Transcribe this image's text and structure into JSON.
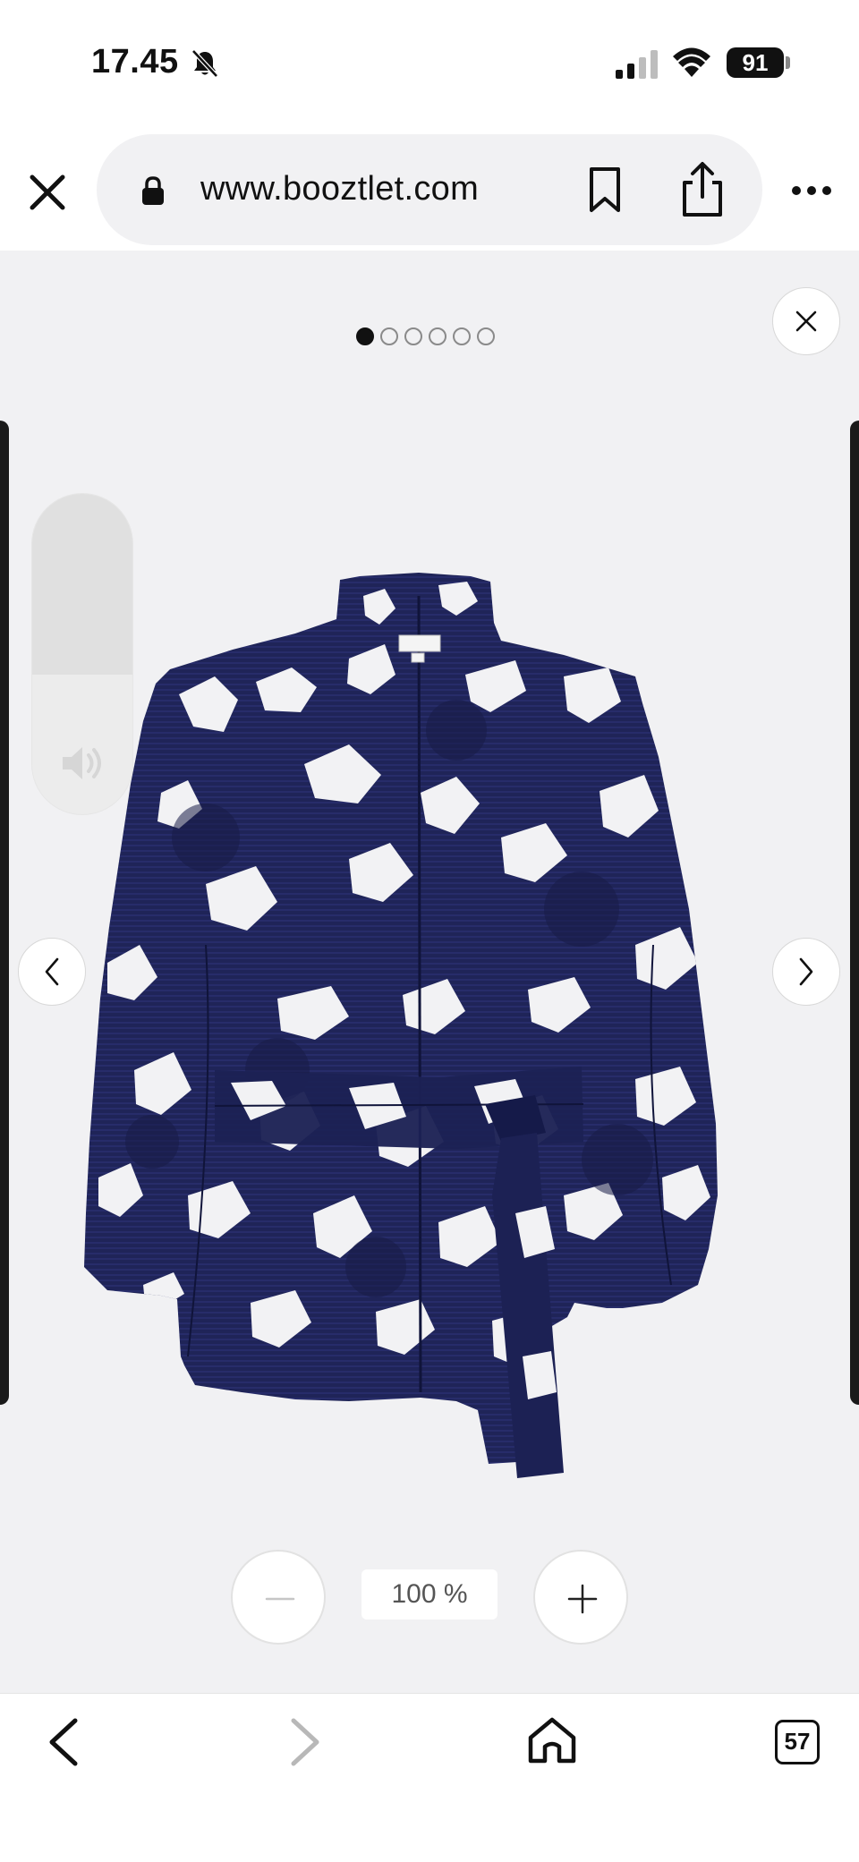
{
  "status_bar": {
    "time": "17.45",
    "battery": "91"
  },
  "browser": {
    "url": "www.booztlet.com"
  },
  "gallery": {
    "image_count": 6,
    "active_index": 0,
    "zoom_level": "100 %"
  },
  "tab_bar": {
    "tabs_count": "57"
  },
  "icons": [
    "bell-slash-icon",
    "signal-icon",
    "wifi-icon",
    "close-icon",
    "lock-icon",
    "bookmark-icon",
    "share-icon",
    "more-icon",
    "chevron-left-icon",
    "chevron-right-icon",
    "speaker-icon",
    "minus-icon",
    "plus-icon",
    "home-icon"
  ],
  "colors": {
    "viewer_background": "#f1f1f3",
    "jacket_navy": "#1f2458",
    "pattern_white": "#f2f2f4"
  }
}
